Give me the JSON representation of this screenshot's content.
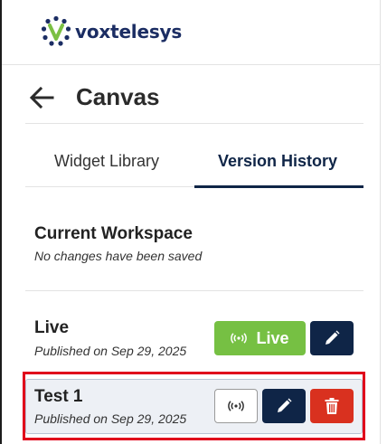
{
  "brand": {
    "name": "voxtelesys"
  },
  "header": {
    "title": "Canvas"
  },
  "tabs": [
    {
      "label": "Widget Library",
      "active": false
    },
    {
      "label": "Version History",
      "active": true
    }
  ],
  "current_workspace": {
    "title": "Current Workspace",
    "subtitle": "No changes have been saved"
  },
  "versions": [
    {
      "name": "Live",
      "published": "Published on Sep 29, 2025",
      "live_label": "Live",
      "is_live": true,
      "selected": false
    },
    {
      "name": "Test 1",
      "published": "Published on Sep 29, 2025",
      "is_live": false,
      "selected": true
    }
  ],
  "icons": {
    "back": "arrow-left-icon",
    "broadcast": "broadcast-icon",
    "edit": "pencil-icon",
    "delete": "trash-icon"
  },
  "colors": {
    "navy": "#0f2547",
    "live_green": "#76c043",
    "delete_red": "#d9311f",
    "highlight_red": "#e0001b",
    "logo_green": "#7bc043",
    "logo_blue": "#1b2d63"
  }
}
